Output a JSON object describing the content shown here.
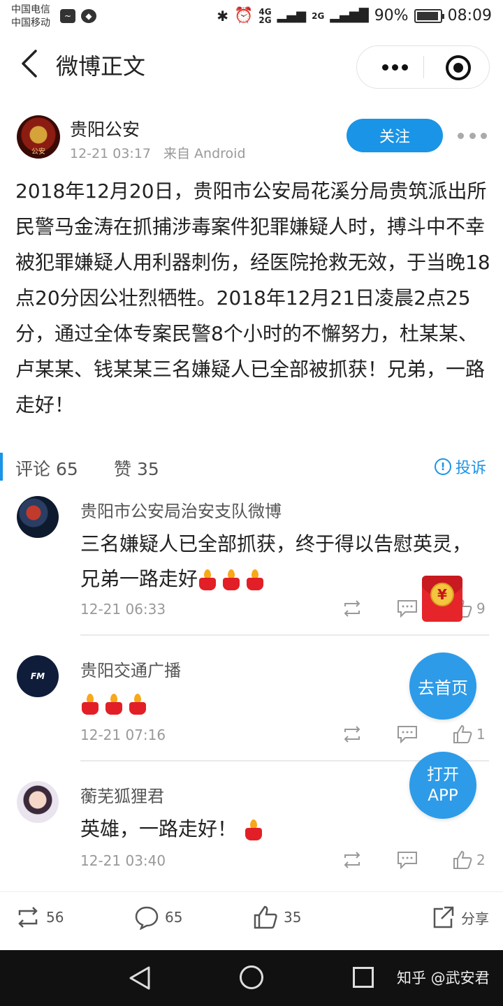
{
  "status_bar": {
    "carrier_1": "中国电信",
    "carrier_2": "中国移动",
    "network_1": "4G",
    "network_2": "2G",
    "network_3": "2G",
    "battery": "90%",
    "time": "08:09"
  },
  "header": {
    "title": "微博正文"
  },
  "post": {
    "author": "贵阳公安",
    "time": "12-21 03:17",
    "source": "来自 Android",
    "follow_label": "关注",
    "text": "2018年12月20日，贵阳市公安局花溪分局贵筑派出所民警马金涛在抓捕涉毒案件犯罪嫌疑人时，搏斗中不幸被犯罪嫌疑人用利器刺伤，经医院抢救无效，于当晚18点20分因公壮烈牺牲。2018年12月21日凌晨2点25分，通过全体专案民警8个小时的不懈努力，杜某某、卢某某、钱某某三名嫌疑人已全部被抓获！兄弟，一路走好！"
  },
  "tabs": {
    "comments": "评论 65",
    "likes": "赞 35",
    "report": "投诉"
  },
  "comments": [
    {
      "author": "贵阳市公安局治安支队微博",
      "text": "三名嫌疑人已全部抓获，终于得以告慰英灵，兄弟一路走好",
      "candles": 3,
      "time": "12-21 06:33",
      "likes": "9"
    },
    {
      "author": "贵阳交通广播",
      "text": "",
      "candles": 3,
      "time": "12-21 07:16",
      "likes": "1"
    },
    {
      "author": "蘅芜狐狸君",
      "text": "英雄，一路走好！",
      "candles": 1,
      "time": "12-21 03:40",
      "likes": "2"
    }
  ],
  "red_packet": {
    "symbol": "¥"
  },
  "floating": {
    "home": "去首页",
    "open_app_line1": "打开",
    "open_app_line2": "APP"
  },
  "bottom_bar": {
    "reposts": "56",
    "comments": "65",
    "likes": "35",
    "share": "分享"
  },
  "watermark": "知乎 @武安君",
  "colors": {
    "accent": "#1a94e6",
    "candle": "#e21f26"
  }
}
